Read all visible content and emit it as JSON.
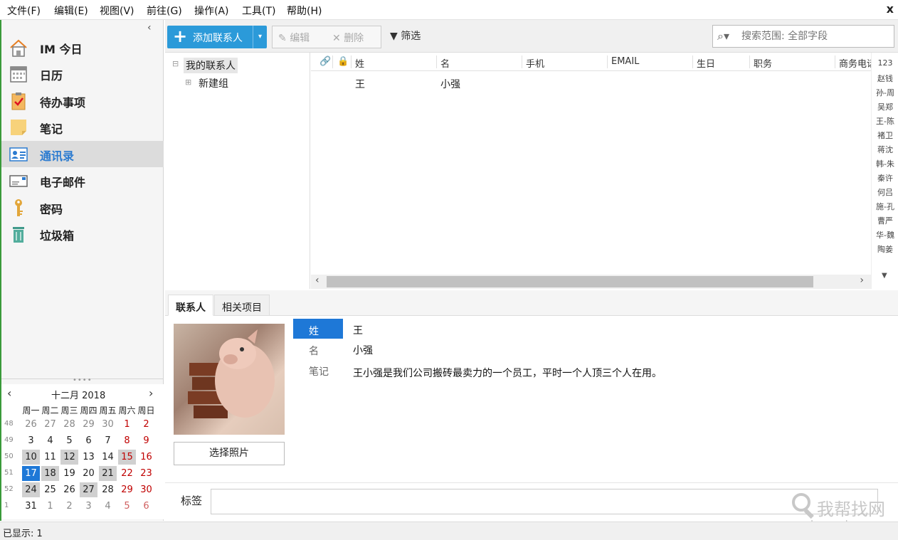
{
  "menu": [
    "文件(F)",
    "编辑(E)",
    "视图(V)",
    "前往(G)",
    "操作(A)",
    "工具(T)",
    "帮助(H)"
  ],
  "window_close": "x",
  "sidebar": {
    "collapse_icon": "‹",
    "items": [
      {
        "label": "IM 今日",
        "icon": "home-icon"
      },
      {
        "label": "日历",
        "icon": "calendar-icon"
      },
      {
        "label": "待办事项",
        "icon": "todo-icon"
      },
      {
        "label": "笔记",
        "icon": "note-icon"
      },
      {
        "label": "通讯录",
        "icon": "contacts-icon",
        "active": true
      },
      {
        "label": "电子邮件",
        "icon": "mail-icon"
      },
      {
        "label": "密码",
        "icon": "key-icon"
      },
      {
        "label": "垃圾箱",
        "icon": "trash-icon"
      }
    ]
  },
  "calendar": {
    "title": "十二月  2018",
    "weekdays": [
      "周一",
      "周二",
      "周三",
      "周四",
      "周五",
      "周六",
      "周日"
    ],
    "weeks": [
      {
        "num": "48",
        "days": [
          "26",
          "27",
          "28",
          "29",
          "30",
          "1",
          "2"
        ]
      },
      {
        "num": "49",
        "days": [
          "3",
          "4",
          "5",
          "6",
          "7",
          "8",
          "9"
        ]
      },
      {
        "num": "50",
        "days": [
          "10",
          "11",
          "12",
          "13",
          "14",
          "15",
          "16"
        ]
      },
      {
        "num": "51",
        "days": [
          "17",
          "18",
          "19",
          "20",
          "21",
          "22",
          "23"
        ]
      },
      {
        "num": "52",
        "days": [
          "24",
          "25",
          "26",
          "27",
          "28",
          "29",
          "30"
        ]
      },
      {
        "num": "1",
        "days": [
          "31",
          "1",
          "2",
          "3",
          "4",
          "5",
          "6"
        ]
      }
    ],
    "today": "17"
  },
  "toolbar": {
    "add_label": "添加联系人",
    "edit_label": "编辑",
    "delete_label": "删除",
    "filter_label": "筛选",
    "search_placeholder": "搜索范围: 全部字段"
  },
  "tree": {
    "root": "我的联系人",
    "child": "新建组"
  },
  "grid": {
    "columns": [
      "姓",
      "名",
      "手机",
      "EMAIL",
      "生日",
      "职务",
      "商务电话"
    ],
    "rows": [
      {
        "surname": "王",
        "given": "小强"
      }
    ]
  },
  "alpha_index": [
    "123",
    "赵钱",
    "孙-周",
    "吴郑",
    "王-陈",
    "褚卫",
    "蒋沈",
    "韩-朱",
    "秦许",
    "何吕",
    "施-孔",
    "曹严",
    "华-魏",
    "陶姜"
  ],
  "details": {
    "tabs": [
      "联系人",
      "相关项目"
    ],
    "choose_photo": "选择照片",
    "fields": [
      {
        "label": "姓",
        "value": "王"
      },
      {
        "label": "名",
        "value": "小强"
      },
      {
        "label": "笔记",
        "value": "王小强是我们公司搬砖最卖力的一个员工，平时一个人顶三个人在用。"
      }
    ],
    "tags_label": "标签"
  },
  "watermark": {
    "line1": "我帮找网",
    "line2": "wobangzhao.com"
  },
  "status": "已显示: 1",
  "colors": {
    "accent": "#1e78d7",
    "add_button": "#2b9ad9",
    "active_nav_text": "#2b7bd0",
    "weekend_red": "#c00000"
  }
}
